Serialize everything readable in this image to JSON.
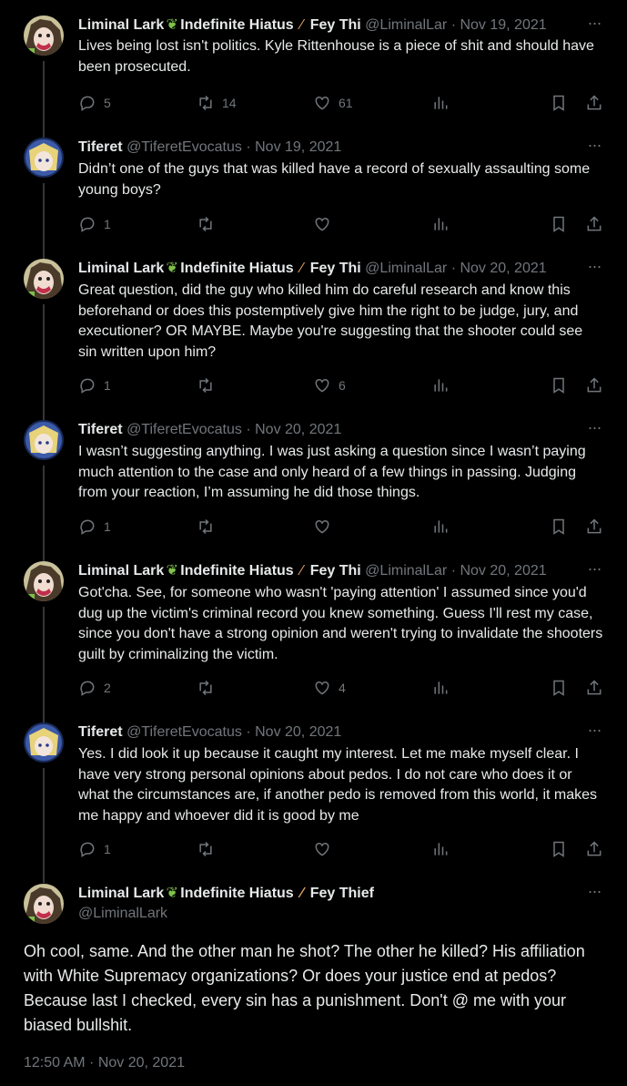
{
  "tweets": [
    {
      "author": "Liminal Lark",
      "name_mid": "Indefinite Hiatus",
      "name_end": "Fey Thi",
      "handle": "@LiminalLar",
      "date": "Nov 19, 2021",
      "text": "Lives being lost isn't politics.  Kyle Rittenhouse is a piece of shit and should have been prosecuted.",
      "replies": "5",
      "retweets": "14",
      "likes": "61"
    },
    {
      "author": "Tiferet",
      "handle": "@TiferetEvocatus",
      "date": "Nov 19, 2021",
      "text": "Didn’t one of the guys that was killed have a record of sexually assaulting some young boys?",
      "replies": "1",
      "retweets": "",
      "likes": ""
    },
    {
      "author": "Liminal Lark",
      "name_mid": "Indefinite Hiatus",
      "name_end": "Fey Thi",
      "handle": "@LiminalLar",
      "date": "Nov 20, 2021",
      "text": "Great question, did the guy who killed him do careful research and know this beforehand or does this postemptively give him the right to be judge, jury, and executioner? OR MAYBE. Maybe you're suggesting that the shooter could see sin written upon him?",
      "replies": "1",
      "retweets": "",
      "likes": "6"
    },
    {
      "author": "Tiferet",
      "handle": "@TiferetEvocatus",
      "date": "Nov 20, 2021",
      "text": "I wasn’t suggesting anything. I was just asking a question since I wasn’t paying much attention to the case and only heard of a few things in passing. Judging from your reaction, I’m assuming he did those things.",
      "replies": "1",
      "retweets": "",
      "likes": ""
    },
    {
      "author": "Liminal Lark",
      "name_mid": "Indefinite Hiatus",
      "name_end": "Fey Thi",
      "handle": "@LiminalLar",
      "date": "Nov 20, 2021",
      "text": "Got'cha. See, for someone who wasn't 'paying attention' I assumed since you'd dug up the victim's criminal record you knew something. Guess I'll rest my case, since you don't have a strong opinion and weren't trying to invalidate the shooters guilt by criminalizing the victim.",
      "replies": "2",
      "retweets": "",
      "likes": "4"
    },
    {
      "author": "Tiferet",
      "handle": "@TiferetEvocatus",
      "date": "Nov 20, 2021",
      "text": "Yes. I did look it up because it caught my interest. Let me make myself clear. I have very strong personal opinions about pedos. I do not care who does it or what the circumstances are, if another pedo is removed from this world, it makes me happy and whoever did it is good by me",
      "replies": "1",
      "retweets": "",
      "likes": ""
    }
  ],
  "main_tweet": {
    "author": "Liminal Lark",
    "name_mid": "Indefinite Hiatus",
    "name_end": "Fey Thief",
    "handle": "@LiminalLark",
    "text": "Oh cool, same.  And the other man he shot?  The other he killed?  His affiliation with White Supremacy organizations?  Or does your justice end at pedos?  Because last I checked, every sin has a punishment.  Don't @ me with your biased bullshit.",
    "timestamp": "12:50 AM · Nov 20, 2021"
  },
  "glyphs": {
    "separator": "·",
    "more": "···",
    "leaf": "❦",
    "knife": "∕"
  },
  "icons": [
    "reply-icon",
    "retweet-icon",
    "like-icon",
    "views-icon",
    "bookmark-icon",
    "share-icon",
    "more-icon"
  ],
  "colors": {
    "background": "#000000",
    "text": "#e7e9ea",
    "muted": "#71767b",
    "thread_line": "#333639"
  }
}
